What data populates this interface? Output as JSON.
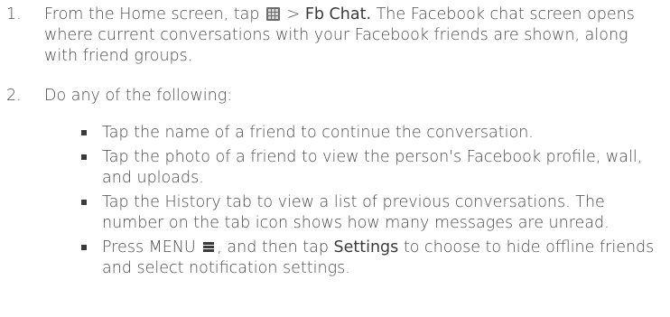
{
  "steps": [
    {
      "number": "1.",
      "text_before_icon": "From the Home screen, tap ",
      "icon": "all-apps-grid-icon",
      "text_after_icon": " > ",
      "bold": "Fb Chat.",
      "text_after_bold": " The Facebook chat screen opens where current conversations with your Facebook friends are shown, along with friend groups."
    },
    {
      "number": "2.",
      "text": "Do any of the following:"
    }
  ],
  "bullets": [
    {
      "text": "Tap the name of a friend to continue the conversation."
    },
    {
      "text": "Tap the photo of a friend to view the person's Facebook profile, wall, and uploads."
    },
    {
      "text": "Tap the History tab to view a list of previous conversations. The number on the tab icon shows how many messages are unread."
    },
    {
      "text_before_icon": "Press MENU ",
      "icon": "menu-icon",
      "text_after_icon": ", and then tap ",
      "bold": "Settings",
      "text_after_bold": " to choose to hide offline friends and select notification settings."
    }
  ],
  "colors": {
    "text": "#4a4a4a",
    "emphasis": "#3a3a3a",
    "bullet": "#3a3a3a",
    "icon": "#6d6d6d"
  }
}
